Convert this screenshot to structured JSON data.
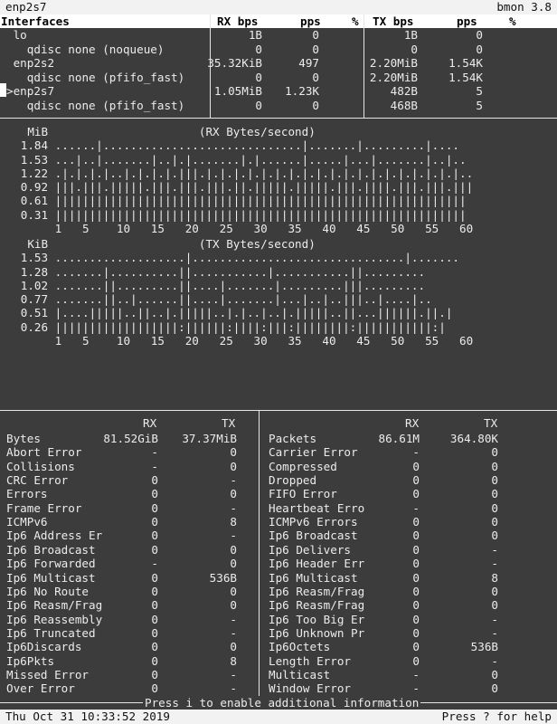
{
  "title_bar": {
    "interface_name": "enp2s7",
    "app_version": "bmon 3.8"
  },
  "iface_header": {
    "col0": "Interfaces",
    "rx_bps": "RX bps",
    "pps": "pps",
    "pct": "%",
    "tx_bps": "TX bps",
    "tx_pps": "pps",
    "tx_pct": "%"
  },
  "interfaces": [
    {
      "name": "lo",
      "indent": 1,
      "rx_bps": "1B",
      "rx_pps": "0",
      "tx_bps": "1B",
      "tx_pps": "0"
    },
    {
      "name": "qdisc none (noqueue)",
      "indent": 3,
      "rx_bps": "0",
      "rx_pps": "0",
      "tx_bps": "0",
      "tx_pps": "0"
    },
    {
      "name": "enp2s2",
      "indent": 1,
      "rx_bps": "35.32KiB",
      "rx_pps": "497",
      "tx_bps": "2.20MiB",
      "tx_pps": "1.54K"
    },
    {
      "name": "qdisc none (pfifo_fast)",
      "indent": 3,
      "rx_bps": "0",
      "rx_pps": "0",
      "tx_bps": "2.20MiB",
      "tx_pps": "1.54K"
    },
    {
      "name": ">enp2s7",
      "indent": 0,
      "rx_bps": "1.05MiB",
      "rx_pps": "1.23K",
      "tx_bps": "482B",
      "tx_pps": "5"
    },
    {
      "name": "qdisc none (pfifo_fast)",
      "indent": 3,
      "rx_bps": "0",
      "rx_pps": "0",
      "tx_bps": "468B",
      "tx_pps": "5"
    }
  ],
  "rx_graph": {
    "text": "    MiB                      (RX Bytes/second)\n   1.84 ......|.............................|.......|.........|....\n   1.53 ...|..|.......|..|.|.......|.|......|.....|...|.......|..|..\n   1.22 .|.|.|.|..|.|.|.|.|||.|.|.|.|.|.|.|.|.|.|.|.|.|.|.|.|.|.|.|..\n   0.92 |||.|||.|||||.|||.|||.|||.||.|||||.|||||.|||.||||.|||.|||.|||\n   0.61 ||||||||||||||||||||||||||||||||||||||||||||||||||||||||||||\n   0.31 ||||||||||||||||||||||||||||||||||||||||||||||||||||||||||||\n        1   5    10   15   20   25   30   35   40   45   50   55   60"
  },
  "tx_graph": {
    "text": "    KiB                      (TX Bytes/second)\n   1.53 ...................|...............................|.......\n   1.28 .......|..........||...........|...........||.........\n   1.02 .......||.........||....|.......|.........|||.........\n   0.77 .......||..|......||....|.......|...|..|..|||..|....|..\n   0.51 |....|||||..||..|.|||||..|.|..|..|.|||||..||...||||||.||.|\n   0.26 ||||||||||||||||||:||||||:||||:|||:||||||||:|||||||||||:|\n        1   5    10   15   20   25   30   35   40   45   50   55   60"
  },
  "stats_header": {
    "rx": "RX",
    "tx": "TX"
  },
  "stats_left": [
    {
      "name": "Bytes",
      "rx": "81.52GiB",
      "tx": "37.37MiB"
    },
    {
      "name": "Abort Error",
      "rx": "-",
      "tx": "0"
    },
    {
      "name": "Collisions",
      "rx": "-",
      "tx": "0"
    },
    {
      "name": "CRC Error",
      "rx": "0",
      "tx": "-"
    },
    {
      "name": "Errors",
      "rx": "0",
      "tx": "0"
    },
    {
      "name": "Frame Error",
      "rx": "0",
      "tx": "-"
    },
    {
      "name": "ICMPv6",
      "rx": "0",
      "tx": "8"
    },
    {
      "name": "Ip6 Address Er",
      "rx": "0",
      "tx": "-"
    },
    {
      "name": "Ip6 Broadcast",
      "rx": "0",
      "tx": "0"
    },
    {
      "name": "Ip6 Forwarded",
      "rx": "-",
      "tx": "0"
    },
    {
      "name": "Ip6 Multicast",
      "rx": "0",
      "tx": "536B"
    },
    {
      "name": "Ip6 No Route",
      "rx": "0",
      "tx": "0"
    },
    {
      "name": "Ip6 Reasm/Frag",
      "rx": "0",
      "tx": "0"
    },
    {
      "name": "Ip6 Reassembly",
      "rx": "0",
      "tx": "-"
    },
    {
      "name": "Ip6 Truncated",
      "rx": "0",
      "tx": "-"
    },
    {
      "name": "Ip6Discards",
      "rx": "0",
      "tx": "0"
    },
    {
      "name": "Ip6Pkts",
      "rx": "0",
      "tx": "8"
    },
    {
      "name": "Missed Error",
      "rx": "0",
      "tx": "-"
    },
    {
      "name": "Over Error",
      "rx": "0",
      "tx": "-"
    }
  ],
  "stats_right": [
    {
      "name": "Packets",
      "rx": "86.61M",
      "tx": "364.80K"
    },
    {
      "name": "Carrier Error",
      "rx": "-",
      "tx": "0"
    },
    {
      "name": "Compressed",
      "rx": "0",
      "tx": "0"
    },
    {
      "name": "Dropped",
      "rx": "0",
      "tx": "0"
    },
    {
      "name": "FIFO Error",
      "rx": "0",
      "tx": "0"
    },
    {
      "name": "Heartbeat Erro",
      "rx": "-",
      "tx": "0"
    },
    {
      "name": "ICMPv6 Errors",
      "rx": "0",
      "tx": "0"
    },
    {
      "name": "Ip6 Broadcast",
      "rx": "0",
      "tx": "0"
    },
    {
      "name": "Ip6 Delivers",
      "rx": "0",
      "tx": "-"
    },
    {
      "name": "Ip6 Header Err",
      "rx": "0",
      "tx": "-"
    },
    {
      "name": "Ip6 Multicast",
      "rx": "0",
      "tx": "8"
    },
    {
      "name": "Ip6 Reasm/Frag",
      "rx": "0",
      "tx": "0"
    },
    {
      "name": "Ip6 Reasm/Frag",
      "rx": "0",
      "tx": "0"
    },
    {
      "name": "Ip6 Too Big Er",
      "rx": "0",
      "tx": "-"
    },
    {
      "name": "Ip6 Unknown Pr",
      "rx": "0",
      "tx": "-"
    },
    {
      "name": "Ip6Octets",
      "rx": "0",
      "tx": "536B"
    },
    {
      "name": "Length Error",
      "rx": "0",
      "tx": "-"
    },
    {
      "name": "Multicast",
      "rx": "-",
      "tx": "0"
    },
    {
      "name": "Window Error",
      "rx": "-",
      "tx": "0"
    }
  ],
  "help_line": "Press i to enable additional information",
  "status_bar": {
    "datetime": "Thu Oct 31 10:33:52 2019",
    "help": "Press ? for help"
  }
}
